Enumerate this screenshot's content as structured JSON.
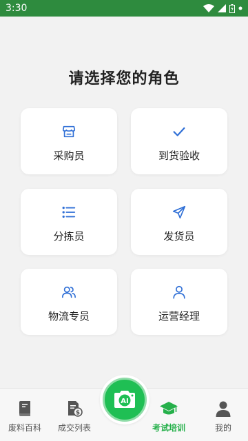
{
  "status_bar": {
    "time": "3:30",
    "icons": [
      "wifi-icon",
      "signal-icon",
      "battery-icon",
      "notification-dot-icon"
    ]
  },
  "title": "请选择您的角色",
  "roles": [
    {
      "label": "采购员",
      "icon": "store-icon"
    },
    {
      "label": "到货验收",
      "icon": "checkmark-icon"
    },
    {
      "label": "分拣员",
      "icon": "list-icon"
    },
    {
      "label": "发货员",
      "icon": "send-icon"
    },
    {
      "label": "物流专员",
      "icon": "users-icon"
    },
    {
      "label": "运营经理",
      "icon": "user-icon"
    }
  ],
  "bottom_nav": {
    "items": [
      {
        "label": "废料百科",
        "icon": "book-icon"
      },
      {
        "label": "成交列表",
        "icon": "document-dollar-icon"
      },
      {
        "label": "",
        "icon": "ai-camera-icon"
      },
      {
        "label": "考试培训",
        "icon": "graduation-cap-icon",
        "active": true
      },
      {
        "label": "我的",
        "icon": "profile-icon"
      }
    ],
    "ai_badge": "AI"
  },
  "colors": {
    "status_bar": "#2e8b3e",
    "accent_blue": "#2f6fd6",
    "active_green": "#25b04a",
    "background": "#f2f2f2"
  }
}
